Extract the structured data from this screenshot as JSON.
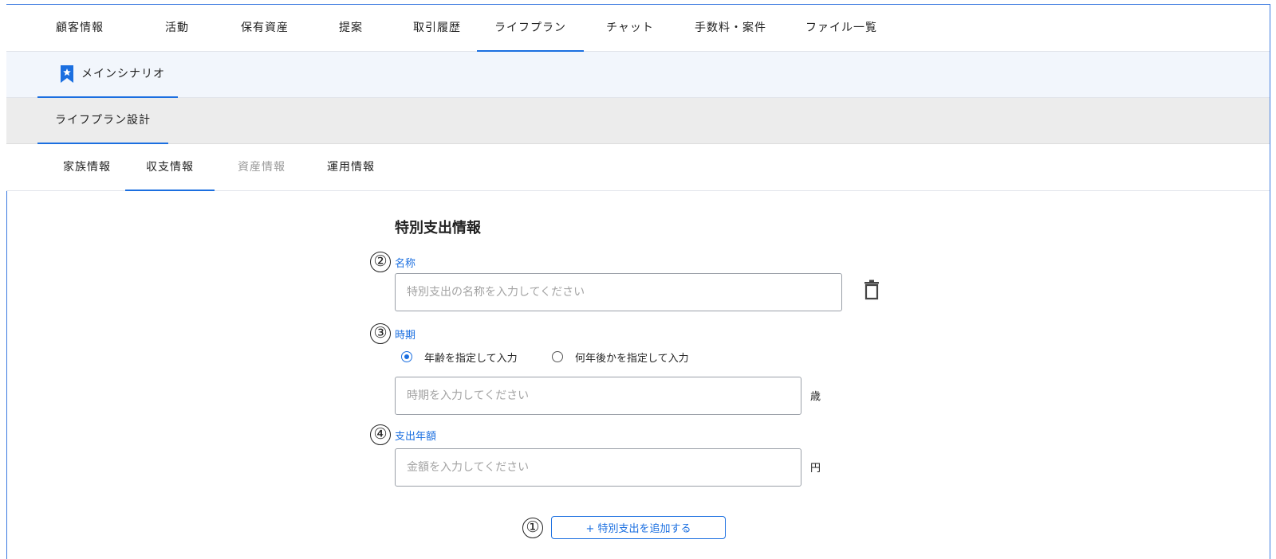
{
  "main_tabs": [
    "顧客情報",
    "活動",
    "保有資産",
    "提案",
    "取引履歴",
    "ライフプラン",
    "チャット",
    "手数料・案件",
    "ファイル一覧"
  ],
  "active_main_tab": "ライフプラン",
  "scenario": {
    "label": "メインシナリオ",
    "icon": "bookmark-star-icon"
  },
  "plan_tab": "ライフプラン設計",
  "sub_tabs": [
    "家族情報",
    "収支情報",
    "資産情報",
    "運用情報"
  ],
  "active_sub_tab": "収支情報",
  "disabled_sub_tab": "資産情報",
  "form": {
    "section_title": "特別支出情報",
    "name": {
      "marker": "②",
      "label": "名称",
      "placeholder": "特別支出の名称を入力してください",
      "value": ""
    },
    "timing": {
      "marker": "③",
      "label": "時期",
      "options": [
        "年齢を指定して入力",
        "何年後かを指定して入力"
      ],
      "selected": "年齢を指定して入力",
      "placeholder": "時期を入力してください",
      "unit": "歳"
    },
    "amount": {
      "marker": "④",
      "label": "支出年額",
      "placeholder": "金額を入力してください",
      "unit": "円"
    },
    "add_button": {
      "marker": "①",
      "label": "+ 特別支出を追加する"
    }
  },
  "colors": {
    "accent": "#1b6fe0",
    "scenario_bg": "#f2f6fc",
    "plan_bg": "#ececec"
  }
}
